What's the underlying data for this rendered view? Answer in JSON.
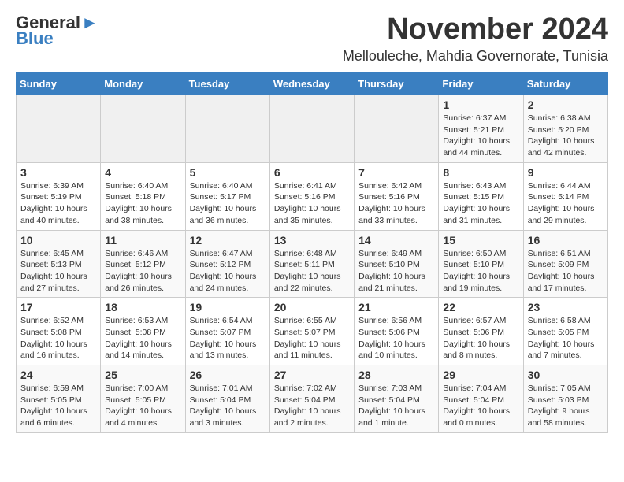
{
  "header": {
    "logo_general": "General",
    "logo_blue": "Blue",
    "month_title": "November 2024",
    "location": "Mellouleche, Mahdia Governorate, Tunisia"
  },
  "weekdays": [
    "Sunday",
    "Monday",
    "Tuesday",
    "Wednesday",
    "Thursday",
    "Friday",
    "Saturday"
  ],
  "weeks": [
    [
      {
        "day": "",
        "info": ""
      },
      {
        "day": "",
        "info": ""
      },
      {
        "day": "",
        "info": ""
      },
      {
        "day": "",
        "info": ""
      },
      {
        "day": "",
        "info": ""
      },
      {
        "day": "1",
        "info": "Sunrise: 6:37 AM\nSunset: 5:21 PM\nDaylight: 10 hours and 44 minutes."
      },
      {
        "day": "2",
        "info": "Sunrise: 6:38 AM\nSunset: 5:20 PM\nDaylight: 10 hours and 42 minutes."
      }
    ],
    [
      {
        "day": "3",
        "info": "Sunrise: 6:39 AM\nSunset: 5:19 PM\nDaylight: 10 hours and 40 minutes."
      },
      {
        "day": "4",
        "info": "Sunrise: 6:40 AM\nSunset: 5:18 PM\nDaylight: 10 hours and 38 minutes."
      },
      {
        "day": "5",
        "info": "Sunrise: 6:40 AM\nSunset: 5:17 PM\nDaylight: 10 hours and 36 minutes."
      },
      {
        "day": "6",
        "info": "Sunrise: 6:41 AM\nSunset: 5:16 PM\nDaylight: 10 hours and 35 minutes."
      },
      {
        "day": "7",
        "info": "Sunrise: 6:42 AM\nSunset: 5:16 PM\nDaylight: 10 hours and 33 minutes."
      },
      {
        "day": "8",
        "info": "Sunrise: 6:43 AM\nSunset: 5:15 PM\nDaylight: 10 hours and 31 minutes."
      },
      {
        "day": "9",
        "info": "Sunrise: 6:44 AM\nSunset: 5:14 PM\nDaylight: 10 hours and 29 minutes."
      }
    ],
    [
      {
        "day": "10",
        "info": "Sunrise: 6:45 AM\nSunset: 5:13 PM\nDaylight: 10 hours and 27 minutes."
      },
      {
        "day": "11",
        "info": "Sunrise: 6:46 AM\nSunset: 5:12 PM\nDaylight: 10 hours and 26 minutes."
      },
      {
        "day": "12",
        "info": "Sunrise: 6:47 AM\nSunset: 5:12 PM\nDaylight: 10 hours and 24 minutes."
      },
      {
        "day": "13",
        "info": "Sunrise: 6:48 AM\nSunset: 5:11 PM\nDaylight: 10 hours and 22 minutes."
      },
      {
        "day": "14",
        "info": "Sunrise: 6:49 AM\nSunset: 5:10 PM\nDaylight: 10 hours and 21 minutes."
      },
      {
        "day": "15",
        "info": "Sunrise: 6:50 AM\nSunset: 5:10 PM\nDaylight: 10 hours and 19 minutes."
      },
      {
        "day": "16",
        "info": "Sunrise: 6:51 AM\nSunset: 5:09 PM\nDaylight: 10 hours and 17 minutes."
      }
    ],
    [
      {
        "day": "17",
        "info": "Sunrise: 6:52 AM\nSunset: 5:08 PM\nDaylight: 10 hours and 16 minutes."
      },
      {
        "day": "18",
        "info": "Sunrise: 6:53 AM\nSunset: 5:08 PM\nDaylight: 10 hours and 14 minutes."
      },
      {
        "day": "19",
        "info": "Sunrise: 6:54 AM\nSunset: 5:07 PM\nDaylight: 10 hours and 13 minutes."
      },
      {
        "day": "20",
        "info": "Sunrise: 6:55 AM\nSunset: 5:07 PM\nDaylight: 10 hours and 11 minutes."
      },
      {
        "day": "21",
        "info": "Sunrise: 6:56 AM\nSunset: 5:06 PM\nDaylight: 10 hours and 10 minutes."
      },
      {
        "day": "22",
        "info": "Sunrise: 6:57 AM\nSunset: 5:06 PM\nDaylight: 10 hours and 8 minutes."
      },
      {
        "day": "23",
        "info": "Sunrise: 6:58 AM\nSunset: 5:05 PM\nDaylight: 10 hours and 7 minutes."
      }
    ],
    [
      {
        "day": "24",
        "info": "Sunrise: 6:59 AM\nSunset: 5:05 PM\nDaylight: 10 hours and 6 minutes."
      },
      {
        "day": "25",
        "info": "Sunrise: 7:00 AM\nSunset: 5:05 PM\nDaylight: 10 hours and 4 minutes."
      },
      {
        "day": "26",
        "info": "Sunrise: 7:01 AM\nSunset: 5:04 PM\nDaylight: 10 hours and 3 minutes."
      },
      {
        "day": "27",
        "info": "Sunrise: 7:02 AM\nSunset: 5:04 PM\nDaylight: 10 hours and 2 minutes."
      },
      {
        "day": "28",
        "info": "Sunrise: 7:03 AM\nSunset: 5:04 PM\nDaylight: 10 hours and 1 minute."
      },
      {
        "day": "29",
        "info": "Sunrise: 7:04 AM\nSunset: 5:04 PM\nDaylight: 10 hours and 0 minutes."
      },
      {
        "day": "30",
        "info": "Sunrise: 7:05 AM\nSunset: 5:03 PM\nDaylight: 9 hours and 58 minutes."
      }
    ]
  ]
}
